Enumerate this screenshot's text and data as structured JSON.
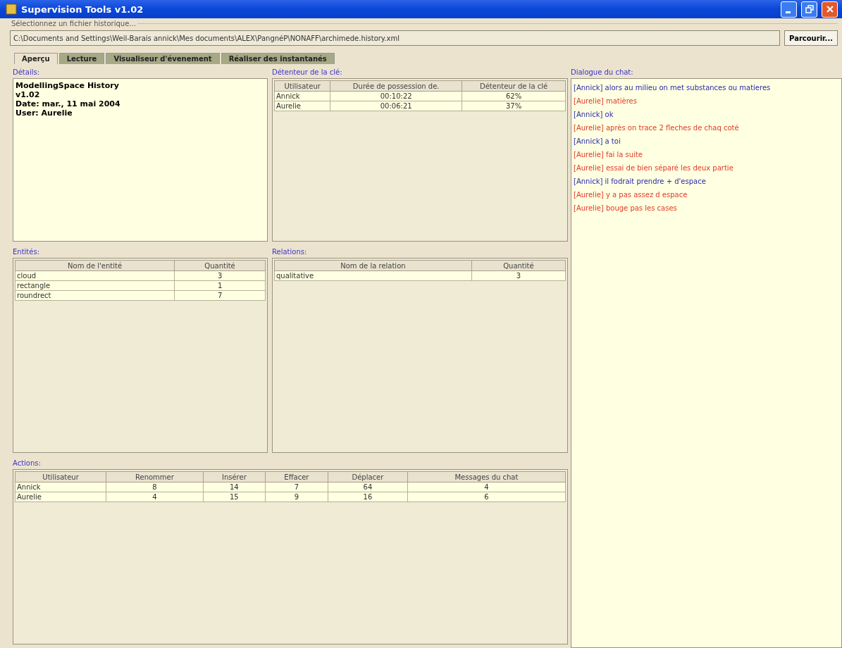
{
  "window": {
    "title": "Supervision Tools v1.02"
  },
  "file_section": {
    "legend": "Sélectionnez un fichier historique...",
    "path": "C:\\Documents and Settings\\Weil-Barais annick\\Mes documents\\ALEX\\PangnéP\\NONAFF\\archimede.history.xml",
    "browse_button": "Parcourir..."
  },
  "tabs": [
    {
      "label": "Aperçu",
      "selected": true
    },
    {
      "label": "Lecture",
      "selected": false
    },
    {
      "label": "Visualiseur d'évenement",
      "selected": false
    },
    {
      "label": "Réaliser des instantanés",
      "selected": false
    }
  ],
  "details": {
    "title": "Détails:",
    "lines": [
      "ModellingSpace History",
      "v1.02",
      "Date: mar., 11 mai 2004",
      "User: Aurelie"
    ]
  },
  "key_holder": {
    "title": "Détenteur de la clé:",
    "columns": [
      "Utilisateur",
      "Durée de possession de.",
      "Détenteur de la clé"
    ],
    "rows": [
      [
        "Annick",
        "00:10:22",
        "62%"
      ],
      [
        "Aurelie",
        "00:06:21",
        "37%"
      ]
    ]
  },
  "entities": {
    "title": "Entités:",
    "columns": [
      "Nom de l'entité",
      "Quantité"
    ],
    "rows": [
      [
        "cloud",
        "3"
      ],
      [
        "rectangle",
        "1"
      ],
      [
        "roundrect",
        "7"
      ]
    ]
  },
  "relations": {
    "title": "Relations:",
    "columns": [
      "Nom de la relation",
      "Quantité"
    ],
    "rows": [
      [
        "qualitative",
        "3"
      ]
    ]
  },
  "actions": {
    "title": "Actions:",
    "columns": [
      "Utilisateur",
      "Renommer",
      "Insérer",
      "Effacer",
      "Déplacer",
      "Messages du chat"
    ],
    "rows": [
      [
        "Annick",
        "8",
        "14",
        "7",
        "64",
        "4"
      ],
      [
        "Aurelie",
        "4",
        "15",
        "9",
        "16",
        "6"
      ]
    ]
  },
  "chat": {
    "title": "Dialogue du chat:",
    "messages": [
      {
        "text": "[Annick] alors au milieu on met substances ou matieres",
        "color": "#2a2ab0"
      },
      {
        "text": "[Aurelie] matières",
        "color": "#e03a2a"
      },
      {
        "text": "[Annick] ok",
        "color": "#2a2ab0"
      },
      {
        "text": "[Aurelie] après on trace 2 fleches de chaq coté",
        "color": "#e03a2a"
      },
      {
        "text": "[Annick] a toi",
        "color": "#2a2ab0"
      },
      {
        "text": "[Aurelie] fai la suite",
        "color": "#e03a2a"
      },
      {
        "text": "[Aurelie] essai de bien séparé les deux partie",
        "color": "#e03a2a"
      },
      {
        "text": "[Annick] il fodrait prendre + d'espace",
        "color": "#2a2ab0"
      },
      {
        "text": "[Aurelie] y a pas assez d espace",
        "color": "#e03a2a"
      },
      {
        "text": "[Aurelie] bouge pas les cases",
        "color": "#e03a2a"
      }
    ]
  }
}
